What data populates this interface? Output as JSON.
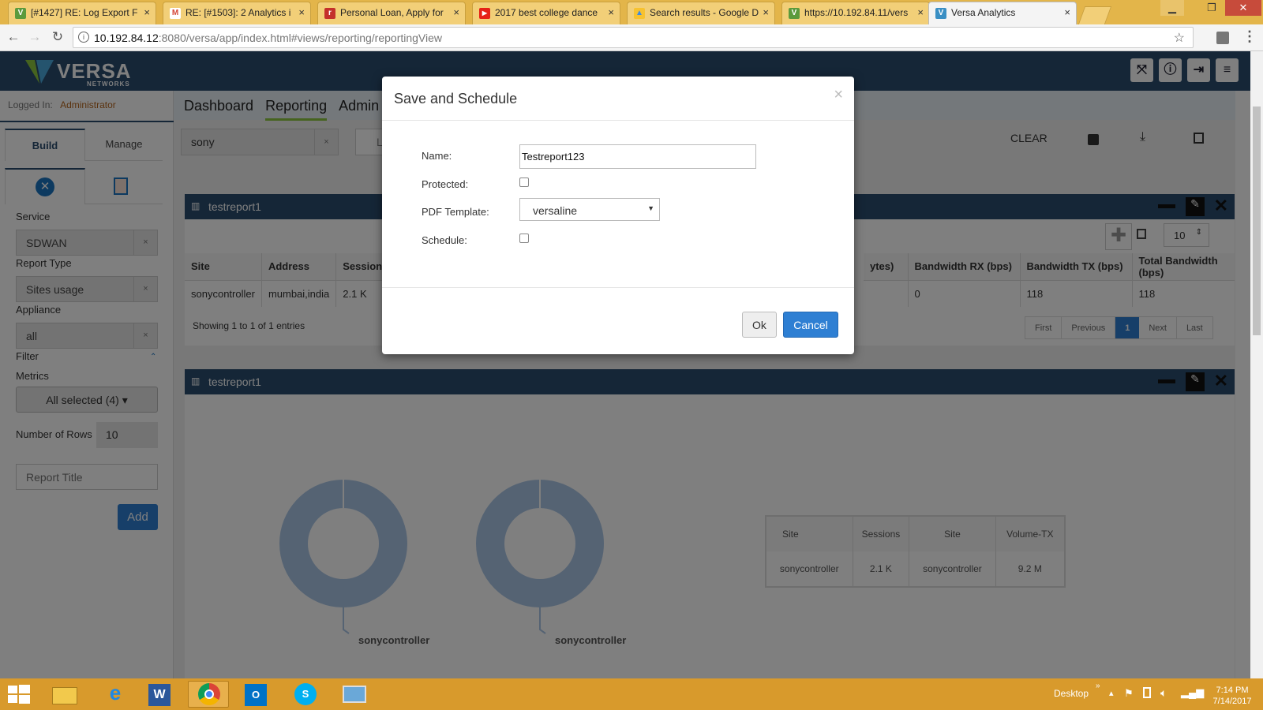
{
  "browser": {
    "tabs": [
      {
        "title": "[#1427] RE: Log Export F",
        "fav": "V",
        "favcolor": "#5b9a3c"
      },
      {
        "title": "RE: [#1503]: 2 Analytics i",
        "fav": "M",
        "favcolor": "#d44638"
      },
      {
        "title": "Personal Loan, Apply for",
        "fav": "r",
        "favcolor": "#c4302b"
      },
      {
        "title": "2017 best college dance",
        "fav": "▶",
        "favcolor": "#e62117"
      },
      {
        "title": "Search results - Google D",
        "fav": "▲",
        "favcolor": "#3b8ae8"
      },
      {
        "title": "https://10.192.84.11/vers",
        "fav": "V",
        "favcolor": "#5b9a3c"
      },
      {
        "title": "Versa Analytics",
        "fav": "V",
        "favcolor": "#3a8fc4"
      }
    ],
    "url_host": "10.192.84.12",
    "url_path": ":8080/versa/app/index.html#views/reporting/reportingView"
  },
  "app": {
    "logo_text": "VERSA",
    "logo_sub": "NETWORKS",
    "logged_in_label": "Logged In:",
    "logged_in_user": "Administrator",
    "nav": [
      "Dashboard",
      "Reporting",
      "Admin"
    ],
    "accent": "#2b4d6e"
  },
  "sidebar": {
    "tabs": [
      "Build",
      "Manage"
    ],
    "service_label": "Service",
    "service_value": "SDWAN",
    "report_type_label": "Report Type",
    "report_type_value": "Sites usage",
    "appliance_label": "Appliance",
    "appliance_value": "all",
    "filter_label": "Filter",
    "metrics_label": "Metrics",
    "metrics_value": "All selected (4) ▾",
    "rows_label": "Number of Rows",
    "rows_value": "10",
    "report_title_placeholder": "Report Title",
    "add_label": "Add"
  },
  "toolbar": {
    "search_value": "sony",
    "second_value": "L",
    "clear_label": "CLEAR"
  },
  "panel1": {
    "title": "testreport1",
    "rows_select": "10",
    "columns_left": [
      "Site",
      "Address",
      "Sessions"
    ],
    "columns_right": [
      "ytes)",
      "Bandwidth RX (bps)",
      "Bandwidth TX (bps)",
      "Total Bandwidth (bps)"
    ],
    "row_left": [
      "sonycontroller",
      "mumbai,india",
      "2.1 K"
    ],
    "row_right": [
      "",
      "0",
      "118",
      "118"
    ],
    "showing": "Showing 1 to 1 of 1 entries",
    "pager": [
      "First",
      "Previous",
      "1",
      "Next",
      "Last"
    ]
  },
  "panel2": {
    "title": "testreport1",
    "donut_labels": [
      "sonycontroller",
      "sonycontroller"
    ],
    "table_headers": [
      "Site",
      "Sessions",
      "Site",
      "Volume-TX"
    ],
    "table_row": [
      "sonycontroller",
      "2.1 K",
      "sonycontroller",
      "9.2 M"
    ]
  },
  "modal": {
    "title": "Save and Schedule",
    "name_label": "Name:",
    "name_value": "Testreport123",
    "protected_label": "Protected:",
    "pdf_label": "PDF Template:",
    "pdf_value": "versaline",
    "schedule_label": "Schedule:",
    "ok_label": "Ok",
    "cancel_label": "Cancel",
    "close_glyph": "×"
  },
  "taskbar": {
    "desktop_label": "Desktop",
    "time": "7:14 PM",
    "date": "7/14/2017"
  }
}
